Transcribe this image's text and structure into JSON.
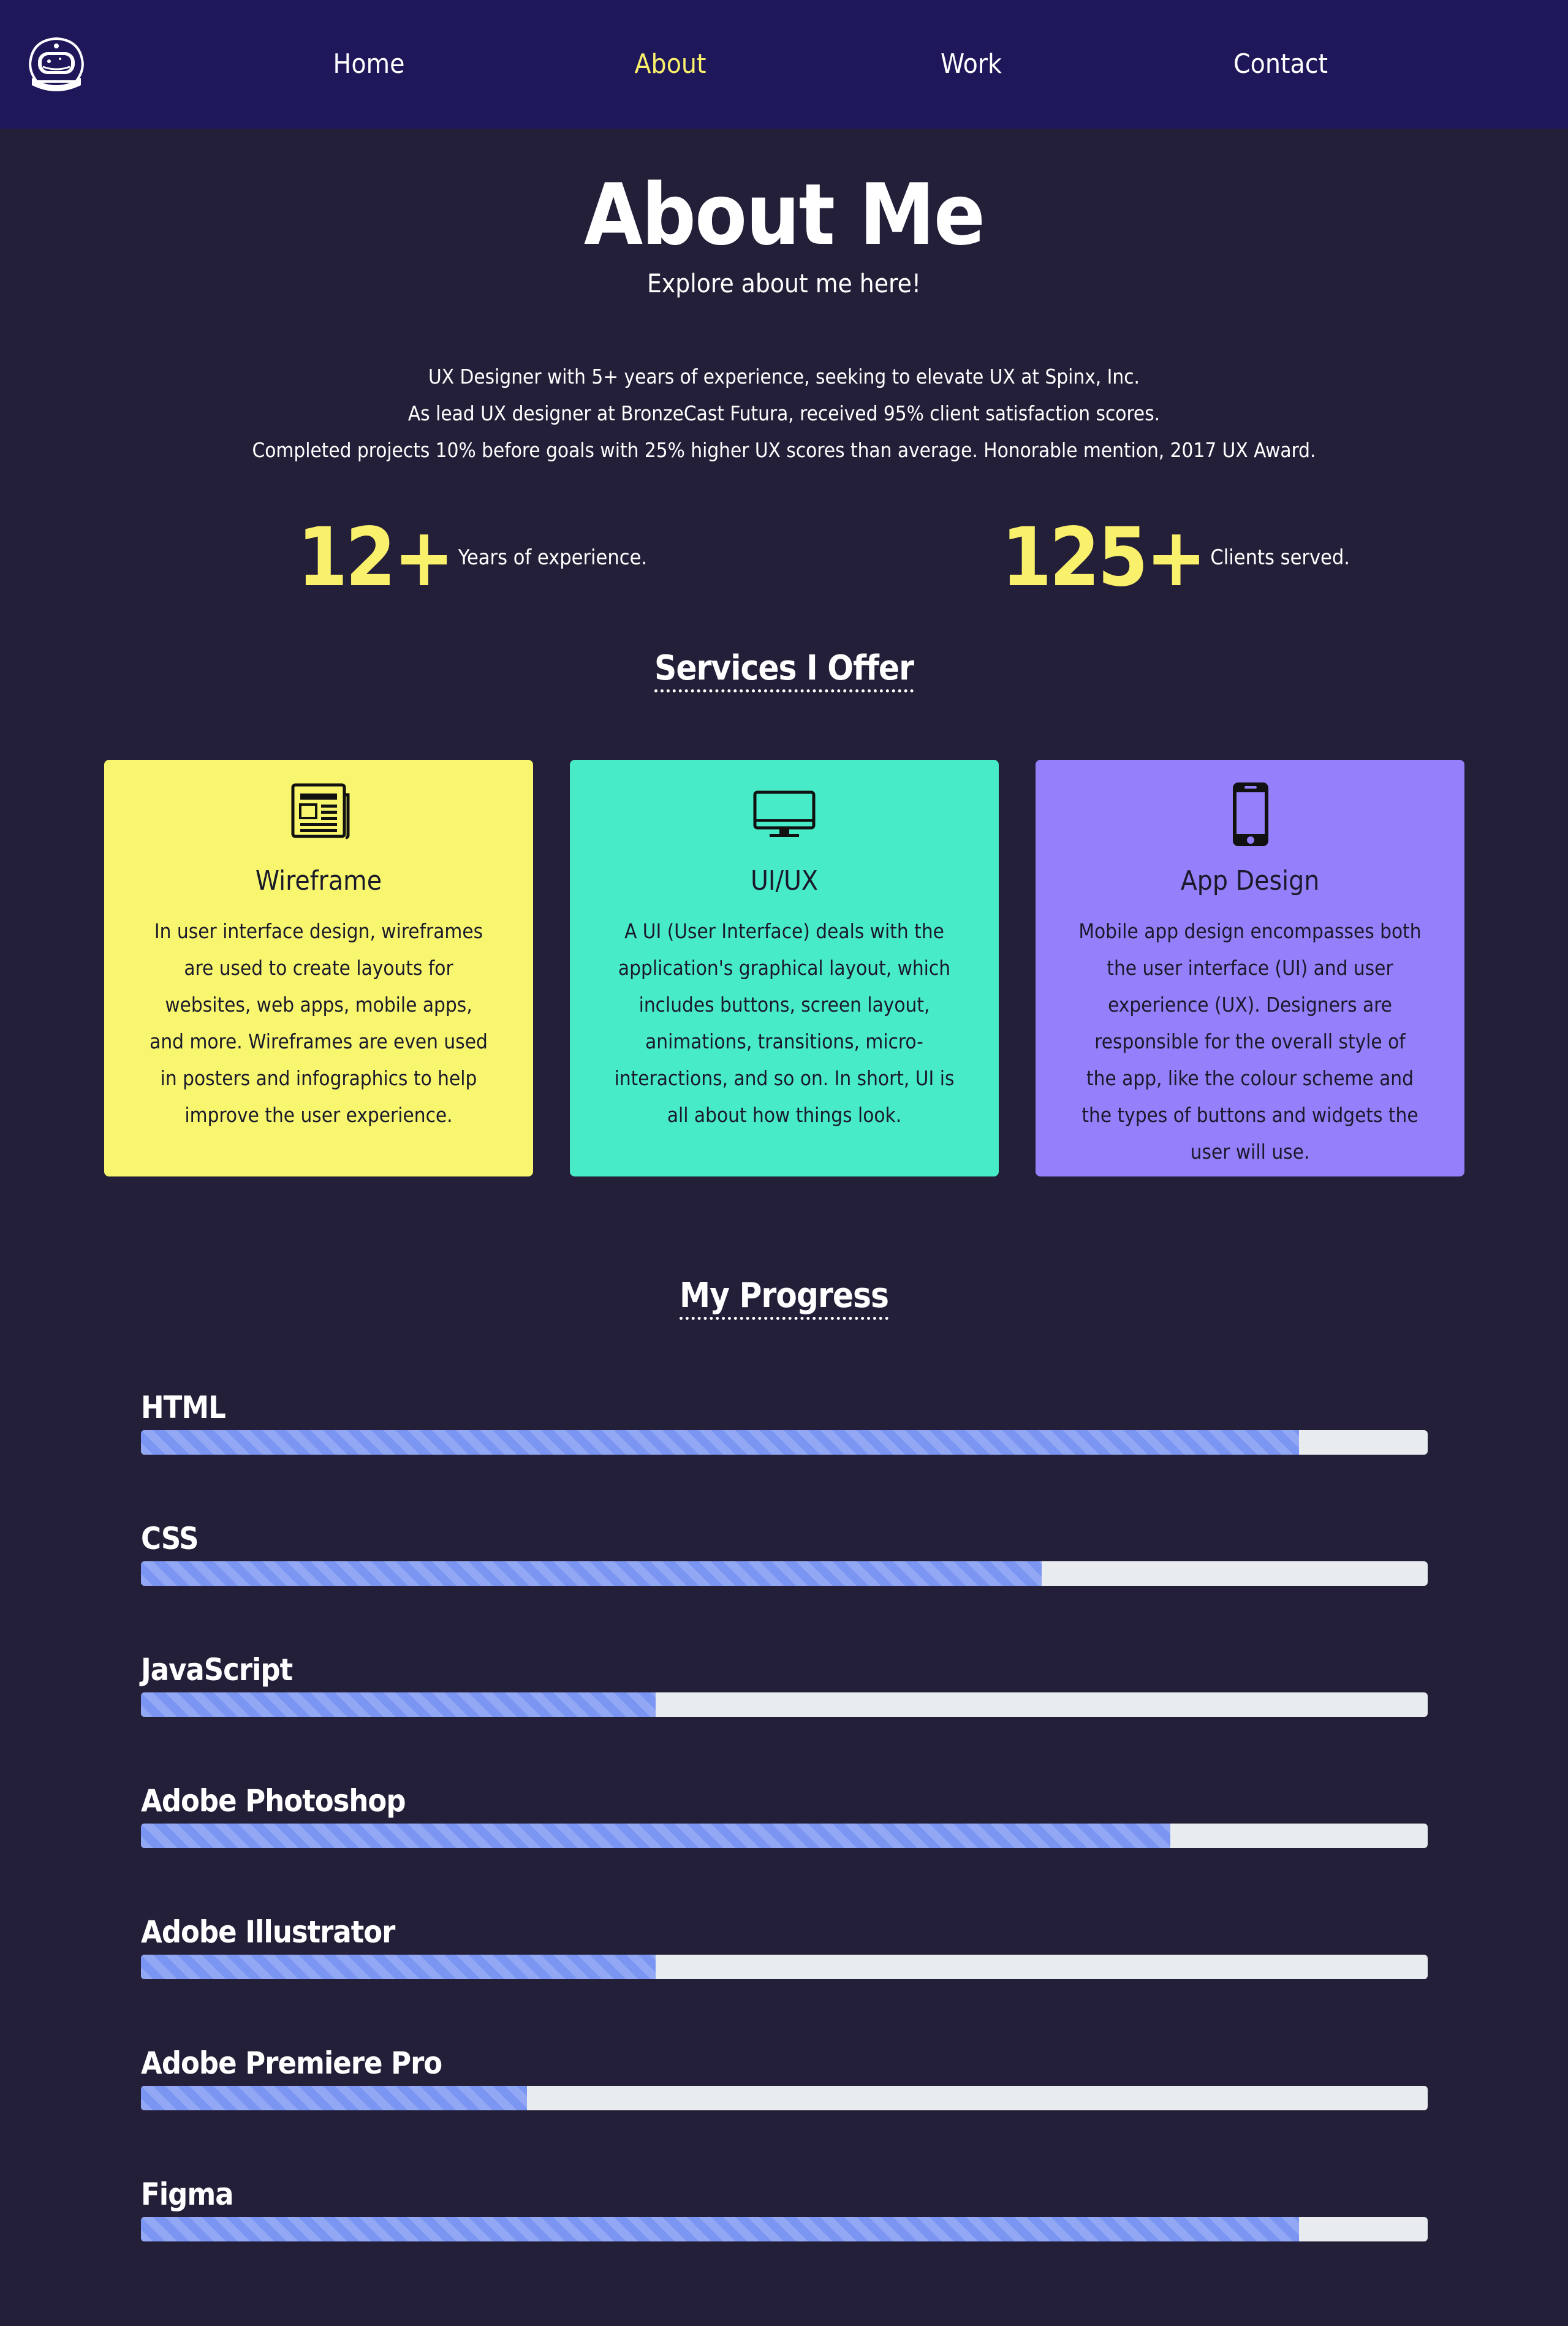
{
  "nav": {
    "logo_icon": "astronaut-helmet-icon",
    "items": [
      {
        "label": "Home",
        "active": false
      },
      {
        "label": "About",
        "active": true
      },
      {
        "label": "Work",
        "active": false
      },
      {
        "label": "Contact",
        "active": false
      }
    ]
  },
  "header": {
    "title": "About Me",
    "subtitle": "Explore about me here!"
  },
  "bio": {
    "lines": [
      "UX Designer with 5+ years of experience, seeking to elevate UX at Spinx, Inc.",
      "As lead UX designer at BronzeCast Futura, received 95% client satisfaction scores.",
      "Completed projects 10% before goals with 25% higher UX scores than average. Honorable mention, 2017 UX Award."
    ]
  },
  "stats": [
    {
      "number": "12+",
      "label": "Years of experience."
    },
    {
      "number": "125+",
      "label": "Clients served."
    }
  ],
  "services": {
    "title": "Services I Offer",
    "cards": [
      {
        "icon": "newspaper-icon",
        "title": "Wireframe",
        "text": "In user interface design, wireframes are used to create layouts for websites, web apps, mobile apps, and more. Wireframes are even used in posters and infographics to help improve the user experience.",
        "color": "#f8f66f"
      },
      {
        "icon": "desktop-monitor-icon",
        "title": "UI/UX",
        "text": "A UI (User Interface) deals with the application's graphical layout, which includes buttons, screen layout, animations, transitions, micro-interactions, and so on. In short, UI is all about how things look.",
        "color": "#48ebc8"
      },
      {
        "icon": "mobile-phone-icon",
        "title": "App Design",
        "text": "Mobile app design encompasses both the user interface (UI) and user experience (UX). Designers are responsible for the overall style of the app, like the colour scheme and the types of buttons and widgets the user will use.",
        "color": "#957ffa"
      }
    ]
  },
  "progress": {
    "title": "My Progress",
    "skills": [
      {
        "name": "HTML",
        "percent": 90
      },
      {
        "name": "CSS",
        "percent": 70
      },
      {
        "name": "JavaScript",
        "percent": 40
      },
      {
        "name": "Adobe Photoshop",
        "percent": 80
      },
      {
        "name": "Adobe Illustrator",
        "percent": 40
      },
      {
        "name": "Adobe Premiere Pro",
        "percent": 30
      },
      {
        "name": "Figma",
        "percent": 90
      }
    ]
  },
  "colors": {
    "background": "#241f38",
    "navbar": "#1e175a",
    "accent": "#f9f06b",
    "bar_fill": "#7b95f2",
    "bar_track": "#e9ecef"
  }
}
